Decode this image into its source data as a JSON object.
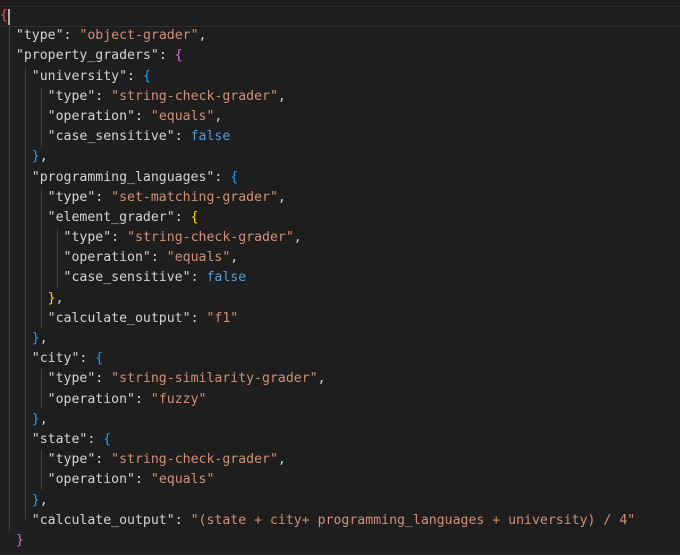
{
  "lines": [
    {
      "indent": "",
      "parts": [
        {
          "t": "{",
          "c": "first-brace"
        }
      ]
    },
    {
      "indent": "  ",
      "parts": [
        {
          "t": "\"type\"",
          "c": "key"
        },
        {
          "t": ": ",
          "c": "punc"
        },
        {
          "t": "\"object-grader\"",
          "c": "str"
        },
        {
          "t": ",",
          "c": "punc"
        }
      ]
    },
    {
      "indent": "  ",
      "parts": [
        {
          "t": "\"property_graders\"",
          "c": "key"
        },
        {
          "t": ": ",
          "c": "punc"
        },
        {
          "t": "{",
          "c": "b2"
        }
      ]
    },
    {
      "indent": "    ",
      "parts": [
        {
          "t": "\"university\"",
          "c": "key"
        },
        {
          "t": ": ",
          "c": "punc"
        },
        {
          "t": "{",
          "c": "b3"
        }
      ]
    },
    {
      "indent": "      ",
      "parts": [
        {
          "t": "\"type\"",
          "c": "key"
        },
        {
          "t": ": ",
          "c": "punc"
        },
        {
          "t": "\"string-check-grader\"",
          "c": "str"
        },
        {
          "t": ",",
          "c": "punc"
        }
      ]
    },
    {
      "indent": "      ",
      "parts": [
        {
          "t": "\"operation\"",
          "c": "key"
        },
        {
          "t": ": ",
          "c": "punc"
        },
        {
          "t": "\"equals\"",
          "c": "str"
        },
        {
          "t": ",",
          "c": "punc"
        }
      ]
    },
    {
      "indent": "      ",
      "parts": [
        {
          "t": "\"case_sensitive\"",
          "c": "key"
        },
        {
          "t": ": ",
          "c": "punc"
        },
        {
          "t": "false",
          "c": "kw"
        }
      ]
    },
    {
      "indent": "    ",
      "parts": [
        {
          "t": "}",
          "c": "b3"
        },
        {
          "t": ",",
          "c": "punc"
        }
      ]
    },
    {
      "indent": "    ",
      "parts": [
        {
          "t": "\"programming_languages\"",
          "c": "key"
        },
        {
          "t": ": ",
          "c": "punc"
        },
        {
          "t": "{",
          "c": "b3"
        }
      ]
    },
    {
      "indent": "      ",
      "parts": [
        {
          "t": "\"type\"",
          "c": "key"
        },
        {
          "t": ": ",
          "c": "punc"
        },
        {
          "t": "\"set-matching-grader\"",
          "c": "str"
        },
        {
          "t": ",",
          "c": "punc"
        }
      ]
    },
    {
      "indent": "      ",
      "parts": [
        {
          "t": "\"element_grader\"",
          "c": "key"
        },
        {
          "t": ": ",
          "c": "punc"
        },
        {
          "t": "{",
          "c": "b1"
        }
      ]
    },
    {
      "indent": "        ",
      "parts": [
        {
          "t": "\"type\"",
          "c": "key"
        },
        {
          "t": ": ",
          "c": "punc"
        },
        {
          "t": "\"string-check-grader\"",
          "c": "str"
        },
        {
          "t": ",",
          "c": "punc"
        }
      ]
    },
    {
      "indent": "        ",
      "parts": [
        {
          "t": "\"operation\"",
          "c": "key"
        },
        {
          "t": ": ",
          "c": "punc"
        },
        {
          "t": "\"equals\"",
          "c": "str"
        },
        {
          "t": ",",
          "c": "punc"
        }
      ]
    },
    {
      "indent": "        ",
      "parts": [
        {
          "t": "\"case_sensitive\"",
          "c": "key"
        },
        {
          "t": ": ",
          "c": "punc"
        },
        {
          "t": "false",
          "c": "kw"
        }
      ]
    },
    {
      "indent": "      ",
      "parts": [
        {
          "t": "}",
          "c": "b1"
        },
        {
          "t": ",",
          "c": "punc"
        }
      ]
    },
    {
      "indent": "      ",
      "parts": [
        {
          "t": "\"calculate_output\"",
          "c": "key"
        },
        {
          "t": ": ",
          "c": "punc"
        },
        {
          "t": "\"f1\"",
          "c": "str"
        }
      ]
    },
    {
      "indent": "    ",
      "parts": [
        {
          "t": "}",
          "c": "b3"
        },
        {
          "t": ",",
          "c": "punc"
        }
      ]
    },
    {
      "indent": "    ",
      "parts": [
        {
          "t": "\"city\"",
          "c": "key"
        },
        {
          "t": ": ",
          "c": "punc"
        },
        {
          "t": "{",
          "c": "b3"
        }
      ]
    },
    {
      "indent": "      ",
      "parts": [
        {
          "t": "\"type\"",
          "c": "key"
        },
        {
          "t": ": ",
          "c": "punc"
        },
        {
          "t": "\"string-similarity-grader\"",
          "c": "str"
        },
        {
          "t": ",",
          "c": "punc"
        }
      ]
    },
    {
      "indent": "      ",
      "parts": [
        {
          "t": "\"operation\"",
          "c": "key"
        },
        {
          "t": ": ",
          "c": "punc"
        },
        {
          "t": "\"fuzzy\"",
          "c": "str"
        }
      ]
    },
    {
      "indent": "    ",
      "parts": [
        {
          "t": "}",
          "c": "b3"
        },
        {
          "t": ",",
          "c": "punc"
        }
      ]
    },
    {
      "indent": "    ",
      "parts": [
        {
          "t": "\"state\"",
          "c": "key"
        },
        {
          "t": ": ",
          "c": "punc"
        },
        {
          "t": "{",
          "c": "b3"
        }
      ]
    },
    {
      "indent": "      ",
      "parts": [
        {
          "t": "\"type\"",
          "c": "key"
        },
        {
          "t": ": ",
          "c": "punc"
        },
        {
          "t": "\"string-check-grader\"",
          "c": "str"
        },
        {
          "t": ",",
          "c": "punc"
        }
      ]
    },
    {
      "indent": "      ",
      "parts": [
        {
          "t": "\"operation\"",
          "c": "key"
        },
        {
          "t": ": ",
          "c": "punc"
        },
        {
          "t": "\"equals\"",
          "c": "str"
        }
      ]
    },
    {
      "indent": "    ",
      "parts": [
        {
          "t": "}",
          "c": "b3"
        },
        {
          "t": ",",
          "c": "punc"
        }
      ]
    },
    {
      "indent": "    ",
      "parts": [
        {
          "t": "\"calculate_output\"",
          "c": "key"
        },
        {
          "t": ": ",
          "c": "punc"
        },
        {
          "t": "\"(state + city+ programming_languages + university) / 4\"",
          "c": "str"
        }
      ]
    },
    {
      "indent": "  ",
      "parts": [
        {
          "t": "}",
          "c": "b2"
        }
      ]
    }
  ],
  "colors": {
    "background": "#1e1e1e",
    "string": "#ce9178",
    "keyword": "#569cd6",
    "text": "#d4d4d4",
    "bracket_gold": "#ffd700",
    "bracket_orchid": "#da70d6",
    "bracket_blue": "#179fff"
  }
}
